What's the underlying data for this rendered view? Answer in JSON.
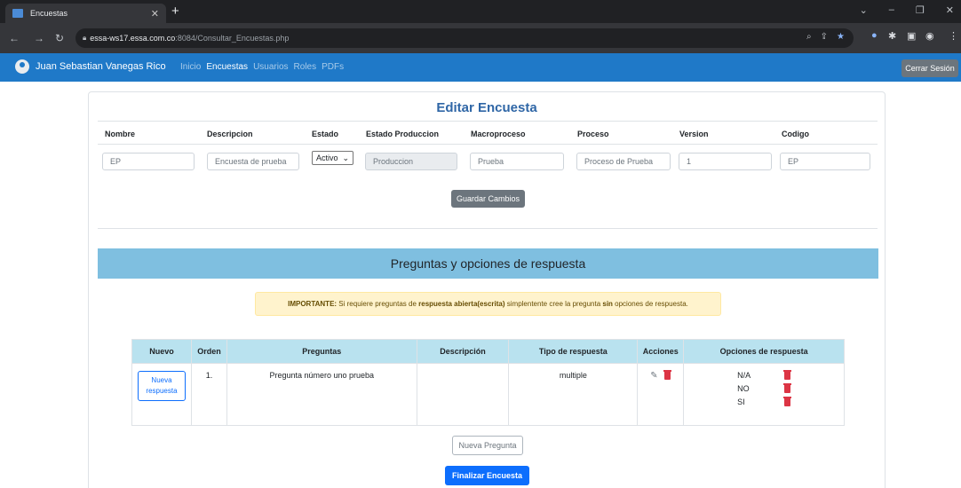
{
  "browser": {
    "tab_title": "Encuestas",
    "url_host": "essa-ws17.essa.com.co",
    "url_path": ":8084/Consultar_Encuestas.php"
  },
  "nav": {
    "user_name": "Juan Sebastian Vanegas Rico",
    "links": [
      "Inicio",
      "Encuestas",
      "Usuarios",
      "Roles",
      "PDFs"
    ],
    "active_link": "Encuestas",
    "logout_label": "Cerrar Sesión"
  },
  "edit": {
    "title": "Editar Encuesta",
    "headers": {
      "nombre": "Nombre",
      "descripcion": "Descripcion",
      "estado": "Estado",
      "estado_produccion": "Estado Produccion",
      "macroproceso": "Macroproceso",
      "proceso": "Proceso",
      "version": "Version",
      "codigo": "Codigo"
    },
    "values": {
      "nombre": "EP",
      "descripcion": "Encuesta de prueba",
      "estado": "Activo",
      "estado_produccion": "Produccion",
      "macroproceso": "Prueba",
      "proceso": "Proceso de Prueba",
      "version": "1",
      "codigo": "EP"
    },
    "save_label": "Guardar Cambios"
  },
  "questions": {
    "section_title": "Preguntas y opciones de respuesta",
    "alert": {
      "prefix": "IMPORTANTE:",
      "t1": " Si requiere preguntas de ",
      "b1": "respuesta abierta(escrita)",
      "t2": " simplentente cree la pregunta ",
      "b2": "sin",
      "t3": " opciones de respuesta."
    },
    "columns": [
      "Nuevo",
      "Orden",
      "Preguntas",
      "Descripción",
      "Tipo de respuesta",
      "Acciones",
      "Opciones de respuesta"
    ],
    "rows": [
      {
        "new_label": "Nueva respuesta",
        "order": "1.",
        "question": "Pregunta número uno prueba",
        "description": "",
        "type": "multiple",
        "options": [
          "N/A",
          "NO",
          "SI"
        ]
      }
    ],
    "new_question_label": "Nueva Pregunta",
    "finish_label": "Finalizar Encuesta"
  },
  "colors": {
    "navbar": "#1f79c8",
    "section_header": "#7fbfe0",
    "table_header": "#b9e2ef",
    "primary": "#0d6efd",
    "danger": "#dc3545"
  }
}
